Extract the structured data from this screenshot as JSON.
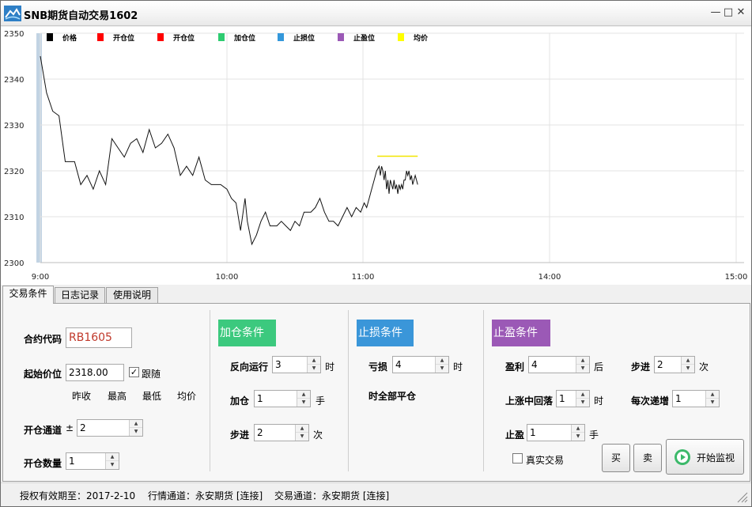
{
  "window": {
    "title": "SNB期货自动交易1602",
    "controls": {
      "minimize": "—",
      "maximize": "□",
      "close": "✕"
    }
  },
  "legend": [
    {
      "label": "价格",
      "color": "#000000"
    },
    {
      "label": "开仓位",
      "color": "#ff0000"
    },
    {
      "label": "开仓位",
      "color": "#ff0000"
    },
    {
      "label": "加仓位",
      "color": "#2ecc71"
    },
    {
      "label": "止损位",
      "color": "#3498db"
    },
    {
      "label": "止盈位",
      "color": "#9b59b6"
    },
    {
      "label": "均价",
      "color": "#ffff00"
    }
  ],
  "chart_data": {
    "type": "line",
    "y_ticks": [
      "2350",
      "2340",
      "2330",
      "2320",
      "2310",
      "2300"
    ],
    "x_ticks": [
      "9:00",
      "10:00",
      "11:00",
      "14:00",
      "15:00"
    ],
    "ylim": [
      2300,
      2350
    ],
    "grid": true,
    "price_series": [
      {
        "t": 0,
        "v": 2345
      },
      {
        "t": 2,
        "v": 2337
      },
      {
        "t": 4,
        "v": 2333
      },
      {
        "t": 6,
        "v": 2332
      },
      {
        "t": 8,
        "v": 2322
      },
      {
        "t": 11,
        "v": 2322
      },
      {
        "t": 13,
        "v": 2317
      },
      {
        "t": 15,
        "v": 2319
      },
      {
        "t": 17,
        "v": 2316
      },
      {
        "t": 19,
        "v": 2320
      },
      {
        "t": 21,
        "v": 2317
      },
      {
        "t": 23,
        "v": 2327
      },
      {
        "t": 25,
        "v": 2325
      },
      {
        "t": 27,
        "v": 2323
      },
      {
        "t": 29,
        "v": 2326
      },
      {
        "t": 31,
        "v": 2327
      },
      {
        "t": 33,
        "v": 2324
      },
      {
        "t": 35,
        "v": 2329
      },
      {
        "t": 37,
        "v": 2325
      },
      {
        "t": 39,
        "v": 2326
      },
      {
        "t": 41,
        "v": 2328
      },
      {
        "t": 43,
        "v": 2325
      },
      {
        "t": 45,
        "v": 2319
      },
      {
        "t": 47,
        "v": 2321
      },
      {
        "t": 49,
        "v": 2319
      },
      {
        "t": 51,
        "v": 2323
      },
      {
        "t": 53,
        "v": 2318
      },
      {
        "t": 55,
        "v": 2317
      },
      {
        "t": 58,
        "v": 2317
      },
      {
        "t": 60,
        "v": 2316
      },
      {
        "t": 62,
        "v": 2314
      },
      {
        "t": 64,
        "v": 2313
      },
      {
        "t": 66,
        "v": 2307
      },
      {
        "t": 68,
        "v": 2314
      },
      {
        "t": 69,
        "v": 2309
      },
      {
        "t": 71,
        "v": 2304
      },
      {
        "t": 73,
        "v": 2306
      },
      {
        "t": 75,
        "v": 2309
      },
      {
        "t": 77,
        "v": 2311
      },
      {
        "t": 79,
        "v": 2308
      },
      {
        "t": 82,
        "v": 2308
      },
      {
        "t": 84,
        "v": 2309
      },
      {
        "t": 86,
        "v": 2308
      },
      {
        "t": 88,
        "v": 2307
      },
      {
        "t": 90,
        "v": 2309
      },
      {
        "t": 92,
        "v": 2308
      },
      {
        "t": 94,
        "v": 2311
      },
      {
        "t": 97,
        "v": 2311
      },
      {
        "t": 99,
        "v": 2312
      },
      {
        "t": 101,
        "v": 2314
      },
      {
        "t": 103,
        "v": 2311
      },
      {
        "t": 105,
        "v": 2309
      },
      {
        "t": 107,
        "v": 2309
      },
      {
        "t": 109,
        "v": 2308
      },
      {
        "t": 111,
        "v": 2310
      },
      {
        "t": 113,
        "v": 2312
      },
      {
        "t": 115,
        "v": 2310
      },
      {
        "t": 117,
        "v": 2312
      },
      {
        "t": 119,
        "v": 2311
      },
      {
        "t": 121,
        "v": 2313
      },
      {
        "t": 123,
        "v": 2312
      },
      {
        "t": 125,
        "v": 2314
      },
      {
        "t": 127,
        "v": 2316
      },
      {
        "t": 129,
        "v": 2318
      },
      {
        "t": 131,
        "v": 2320
      },
      {
        "t": 133,
        "v": 2321
      },
      {
        "t": 134,
        "v": 2319
      },
      {
        "t": 135,
        "v": 2321
      },
      {
        "t": 136,
        "v": 2320
      },
      {
        "t": 137,
        "v": 2318
      },
      {
        "t": 138,
        "v": 2320
      },
      {
        "t": 139,
        "v": 2316
      },
      {
        "t": 140,
        "v": 2318
      },
      {
        "t": 141,
        "v": 2315
      },
      {
        "t": 142,
        "v": 2318
      },
      {
        "t": 143,
        "v": 2317
      },
      {
        "t": 144,
        "v": 2316
      },
      {
        "t": 145,
        "v": 2318
      },
      {
        "t": 146,
        "v": 2316
      },
      {
        "t": 147,
        "v": 2317
      },
      {
        "t": 148,
        "v": 2315
      },
      {
        "t": 149,
        "v": 2317
      },
      {
        "t": 150,
        "v": 2316
      },
      {
        "t": 151,
        "v": 2317
      },
      {
        "t": 152,
        "v": 2316
      },
      {
        "t": 153,
        "v": 2318
      },
      {
        "t": 154,
        "v": 2318
      },
      {
        "t": 155,
        "v": 2320
      },
      {
        "t": 156,
        "v": 2319
      },
      {
        "t": 157,
        "v": 2320
      },
      {
        "t": 158,
        "v": 2318
      },
      {
        "t": 159,
        "v": 2319
      },
      {
        "t": 160,
        "v": 2317
      },
      {
        "t": 161,
        "v": 2318
      },
      {
        "t": 162,
        "v": 2319
      },
      {
        "t": 163,
        "v": 2318
      },
      {
        "t": 164,
        "v": 2317
      }
    ],
    "avg_price": {
      "value": 2323.2,
      "t_start": 129,
      "t_end": 164
    },
    "t_range": [
      0,
      270
    ]
  },
  "tabs": [
    {
      "label": "交易条件",
      "active": true
    },
    {
      "label": "日志记录",
      "active": false
    },
    {
      "label": "使用说明",
      "active": false
    }
  ],
  "trade": {
    "contract_label": "合约代码",
    "contract_value": "RB1605",
    "start_price_label": "起始价位",
    "start_price_value": "2318.00",
    "follow_label": "跟随",
    "follow_checked": true,
    "price_refs": [
      "昨收",
      "最高",
      "最低",
      "均价"
    ],
    "open_channel_label": "开仓通道",
    "pm_sign": "±",
    "open_channel_value": "2",
    "open_qty_label": "开仓数量",
    "open_qty_value": "1"
  },
  "add_section": {
    "header": "加仓条件",
    "reverse_label": "反向运行",
    "reverse_value": "3",
    "reverse_unit": "时",
    "add_label": "加仓",
    "add_value": "1",
    "add_unit": "手",
    "step_label": "步进",
    "step_value": "2",
    "step_unit": "次"
  },
  "stoploss_section": {
    "header": "止损条件",
    "loss_label": "亏损",
    "loss_value": "4",
    "loss_unit": "时",
    "close_all_text": "时全部平仓"
  },
  "takeprofit_section": {
    "header": "止盈条件",
    "profit_label": "盈利",
    "profit_value": "4",
    "profit_unit": "后",
    "step_label": "步进",
    "step_value": "2",
    "step_unit": "次",
    "pullback_label": "上涨中回落",
    "pullback_value": "1",
    "pullback_unit": "时",
    "increment_label": "每次递增",
    "increment_value": "1",
    "tp_label": "止盈",
    "tp_value": "1",
    "tp_unit": "手",
    "real_trade_label": "真实交易",
    "real_trade_checked": false
  },
  "buttons": {
    "buy": "买",
    "sell": "卖",
    "start_monitor": "开始监视"
  },
  "colors": {
    "add_header": "#3cc97e",
    "stoploss_header": "#3a96d9",
    "takeprofit_header": "#9b59b6"
  },
  "status": {
    "license": "授权有效期至：2017-2-10",
    "market_channel": "行情通道：永安期货 [连接]",
    "trade_channel": "交易通道：永安期货 [连接]"
  }
}
